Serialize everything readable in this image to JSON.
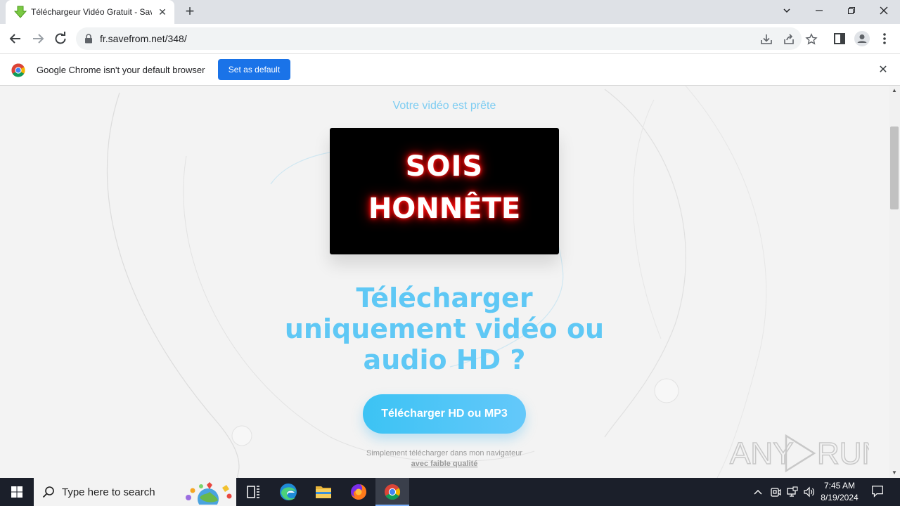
{
  "browser": {
    "tab": {
      "title": "Téléchargeur Vidéo Gratuit - SaveFrom.net",
      "close": "✕"
    },
    "new_tab": "+",
    "window_controls": {
      "tabsearch": "⌄",
      "minimize": "—",
      "restore": "❐",
      "close": "✕"
    },
    "url": "fr.savefrom.net/348/",
    "infobar": {
      "message": "Google Chrome isn't your default browser",
      "button": "Set as default",
      "close": "✕"
    }
  },
  "page": {
    "ready_text": "Votre vidéo est prête",
    "video_text_line1": "SOIS",
    "video_text_line2": "HONNÊTE",
    "headline": "Télécharger uniquement vidéo ou audio HD ?",
    "cta_button": "Télécharger HD ou MP3",
    "simple_text": "Simplement télécharger dans mon navigateur",
    "low_quality_link": "avec faible qualité",
    "watermark": "ANY RUN"
  },
  "taskbar": {
    "search_placeholder": "Type here to search",
    "time": "7:45 AM",
    "date": "8/19/2024"
  },
  "colors": {
    "accent_blue": "#5fc8f5",
    "chrome_blue": "#1a73e8",
    "taskbar": "#1b1f2a"
  }
}
